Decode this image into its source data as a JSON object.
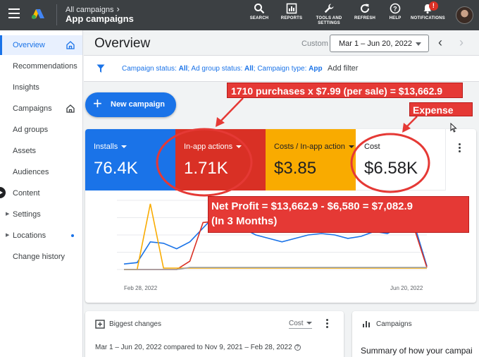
{
  "topbar": {
    "breadcrumb": "All campaigns",
    "app_title": "App campaigns",
    "tools": [
      {
        "icon": "search-icon",
        "label": "SEARCH"
      },
      {
        "icon": "reports-icon",
        "label": "REPORTS"
      },
      {
        "icon": "wrench-icon",
        "label": "TOOLS AND SETTINGS"
      },
      {
        "icon": "refresh-icon",
        "label": "REFRESH"
      },
      {
        "icon": "help-icon",
        "label": "HELP"
      },
      {
        "icon": "bell-icon",
        "label": "NOTIFICATIONS",
        "badge": "!"
      }
    ]
  },
  "sidebar": {
    "items": [
      {
        "label": "Overview",
        "active": true
      },
      {
        "label": "Recommendations"
      },
      {
        "label": "Insights"
      },
      {
        "label": "Campaigns"
      },
      {
        "label": "Ad groups"
      },
      {
        "label": "Assets"
      },
      {
        "label": "Audiences"
      },
      {
        "label": "Content"
      },
      {
        "label": "Settings"
      },
      {
        "label": "Locations"
      },
      {
        "label": "Change history"
      }
    ]
  },
  "header": {
    "title": "Overview",
    "custom_label": "Custom",
    "date_range": "Mar 1 – Jun 20, 2022"
  },
  "filters": {
    "campaign_status_label": "Campaign status:",
    "campaign_status_value": "All",
    "ad_group_status_label": "; Ad group status:",
    "ad_group_status_value": "All",
    "campaign_type_label": "; Campaign type:",
    "campaign_type_value": "App",
    "add_filter": "Add filter"
  },
  "actions": {
    "new_campaign": "New campaign"
  },
  "scorecards": [
    {
      "label": "Installs",
      "value": "76.4K",
      "bg": "#1a73e8",
      "fg": "#ffffff",
      "dropdown": true
    },
    {
      "label": "In-app actions",
      "value": "1.71K",
      "bg": "#d93025",
      "fg": "#ffffff",
      "dropdown": true
    },
    {
      "label": "Costs / In-app action",
      "value": "$3.85",
      "bg": "#f9ab00",
      "fg": "#202124",
      "dropdown": true
    },
    {
      "label": "Cost",
      "value": "$6.58K",
      "bg": "#ffffff",
      "fg": "#202124",
      "dropdown": false
    }
  ],
  "chart_data": {
    "type": "line",
    "x_start_label": "Feb 28, 2022",
    "x_end_label": "Jun 20, 2022",
    "grid": true,
    "note": "relative values (0-100); y axis not labeled",
    "series": [
      {
        "color": "#1a73e8",
        "values": [
          8,
          10,
          40,
          38,
          30,
          40,
          60,
          80,
          82,
          60,
          50,
          45,
          40,
          45,
          50,
          52,
          50,
          45,
          48,
          55,
          52,
          62,
          68,
          5
        ]
      },
      {
        "color": "#d93025",
        "values": [
          0,
          0,
          0,
          0,
          0,
          12,
          68,
          70,
          72,
          78,
          70,
          64,
          70,
          74,
          72,
          62,
          58,
          64,
          68,
          72,
          74,
          70,
          62,
          3
        ]
      },
      {
        "color": "#f9ab00",
        "values": [
          0,
          0,
          95,
          2,
          2,
          2,
          2,
          2,
          2,
          2,
          2,
          2,
          2,
          2,
          2,
          2,
          2,
          2,
          2,
          2,
          2,
          2,
          2,
          2
        ]
      },
      {
        "color": "#9aa0a6",
        "values": [
          0,
          0,
          0,
          0,
          0,
          3,
          3,
          3,
          3,
          3,
          3,
          3,
          3,
          3,
          3,
          3,
          3,
          3,
          3,
          3,
          3,
          3,
          3,
          3
        ]
      }
    ]
  },
  "biggest_changes": {
    "title": "Biggest changes",
    "metric": "Cost",
    "comparison": "Mar 1 – Jun 20, 2022 compared to Nov 9, 2021 – Feb 28, 2022"
  },
  "campaigns_card": {
    "title": "Campaigns",
    "summary": "Summary of how your campai"
  },
  "annotations": {
    "purchases": "1710 purchases x $7.99 (per sale) = $13,662.9",
    "expense": "Expense",
    "profit_line1": "Net Profit = $13,662.9 - $6,580 = $7,082.9",
    "profit_line2": "(In 3 Months)",
    "color": "#e53935"
  }
}
